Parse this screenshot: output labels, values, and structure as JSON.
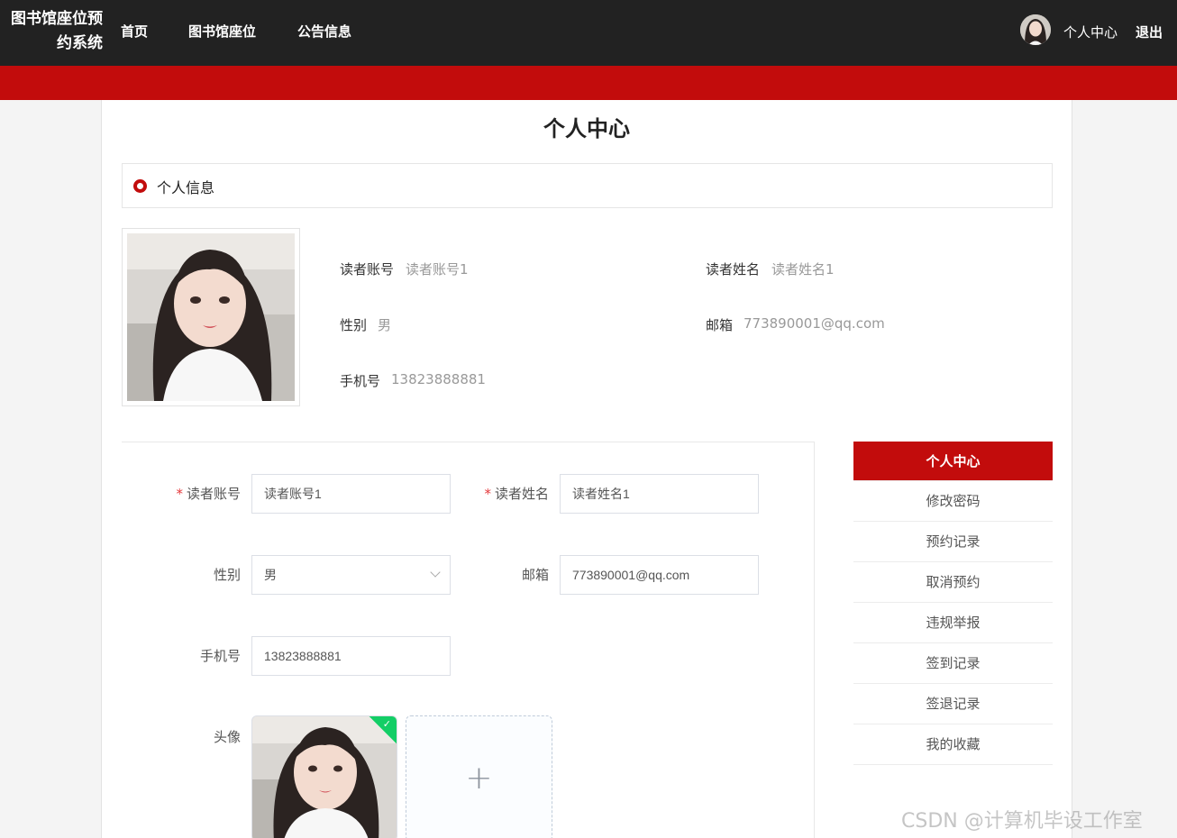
{
  "header": {
    "brand": "图书馆座位预约系统",
    "nav": [
      "首页",
      "图书馆座位",
      "公告信息"
    ],
    "user_center": "个人中心",
    "logout": "退出"
  },
  "page": {
    "title": "个人中心",
    "section_title": "个人信息"
  },
  "profile": {
    "account_label": "读者账号",
    "account_value": "读者账号1",
    "name_label": "读者姓名",
    "name_value": "读者姓名1",
    "gender_label": "性别",
    "gender_value": "男",
    "email_label": "邮箱",
    "email_value": "773890001@qq.com",
    "phone_label": "手机号",
    "phone_value": "13823888881"
  },
  "form": {
    "account_label": "读者账号",
    "account_value": "读者账号1",
    "name_label": "读者姓名",
    "name_value": "读者姓名1",
    "gender_label": "性别",
    "gender_value": "男",
    "email_label": "邮箱",
    "email_value": "773890001@qq.com",
    "phone_label": "手机号",
    "phone_value": "13823888881",
    "avatar_label": "头像",
    "required_mark": "*",
    "upload_plus": "+",
    "upload_check": "✓"
  },
  "menu": {
    "items": [
      "个人中心",
      "修改密码",
      "预约记录",
      "取消预约",
      "违规举报",
      "签到记录",
      "签退记录",
      "我的收藏"
    ],
    "active_index": 0
  },
  "watermark": "CSDN @计算机毕设工作室",
  "colors": {
    "topbar": "#222222",
    "accent": "#c20c0c",
    "success": "#13ce66"
  }
}
